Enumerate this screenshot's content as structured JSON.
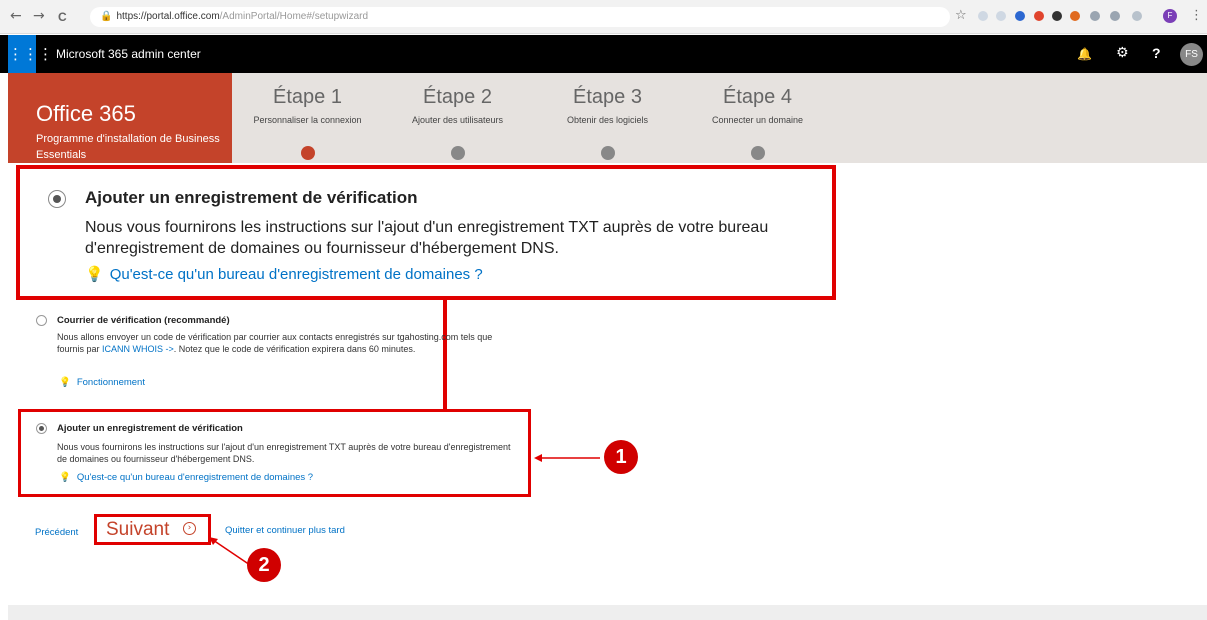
{
  "browser": {
    "nav": {
      "back_icon": "←",
      "forward_icon": "→",
      "reload_icon": "C"
    },
    "url_prefix": "https://portal.office.com",
    "url_path": "/AdminPortal/Home#/setupwizard",
    "star_icon": "☆",
    "profile_initial": "F",
    "menu_icon": "⋮"
  },
  "suite": {
    "waffle_icon": "⋮⋮⋮",
    "app_title": "Microsoft 365 admin center",
    "bell_icon": "🔔",
    "gear_icon": "⚙",
    "help_icon": "?",
    "user_initials": "FS"
  },
  "wizard": {
    "brand_title": "Office 365",
    "brand_subtitle": "Programme d'installation de Business Essentials",
    "steps": [
      {
        "title": "Étape 1",
        "subtitle": "Personnaliser la connexion",
        "active": true
      },
      {
        "title": "Étape 2",
        "subtitle": "Ajouter des utilisateurs",
        "active": false
      },
      {
        "title": "Étape 3",
        "subtitle": "Obtenir des logiciels",
        "active": false
      },
      {
        "title": "Étape 4",
        "subtitle": "Connecter un domaine",
        "active": false
      }
    ]
  },
  "zoom": {
    "title": "Ajouter un enregistrement de vérification",
    "description": "Nous vous fournirons les instructions sur l'ajout d'un enregistrement TXT auprès de votre bureau d'enregistrement de domaines ou fournisseur d'hébergement DNS.",
    "bulb_icon": "💡",
    "link": "Qu'est-ce qu'un bureau d'enregistrement de domaines ?"
  },
  "option_mail": {
    "title": "Courrier de vérification (recommandé)",
    "desc_before": "Nous allons envoyer un code de vérification par courrier aux contacts enregistrés sur tgahosting.com tels que fournis par ",
    "desc_link": "ICANN WHOIS ->",
    "desc_after": ". Notez que le code de vérification expirera dans 60 minutes.",
    "bulb_icon": "💡",
    "link": "Fonctionnement"
  },
  "option_txt": {
    "title": "Ajouter un enregistrement de vérification",
    "description": "Nous vous fournirons les instructions sur l'ajout d'un enregistrement TXT auprès de votre bureau d'enregistrement de domaines ou fournisseur d'hébergement DNS.",
    "bulb_icon": "💡",
    "link": "Qu'est-ce qu'un bureau d'enregistrement de domaines ?"
  },
  "annotations": {
    "badge_1": "1",
    "badge_2": "2"
  },
  "footer": {
    "previous": "Précédent",
    "next": "Suivant",
    "next_icon": "›",
    "later": "Quitter et continuer plus tard"
  },
  "colors": {
    "accent": "#c4432a",
    "highlight": "#e00000",
    "link": "#0072c6",
    "waffle": "#0078d7"
  }
}
